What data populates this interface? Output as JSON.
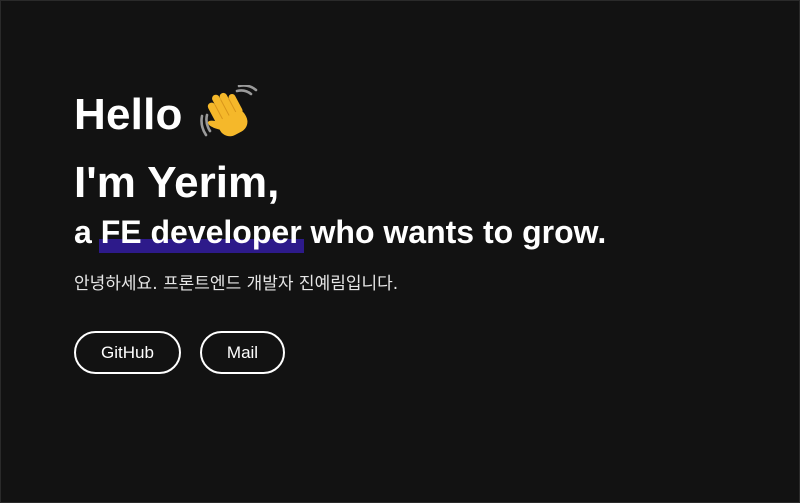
{
  "hero": {
    "greeting": "Hello",
    "wave_emoji": "wave-hand-icon",
    "intro": "I'm Yerim,",
    "tagline_prefix": "a ",
    "tagline_highlight": "FE developer",
    "tagline_suffix": " who wants to grow.",
    "subtitle": "안녕하세요. 프론트엔드 개발자 진예림입니다."
  },
  "links": {
    "github_label": "GitHub",
    "mail_label": "Mail"
  },
  "colors": {
    "background": "#121212",
    "text": "#ffffff",
    "highlight": "#2d1a8a"
  }
}
